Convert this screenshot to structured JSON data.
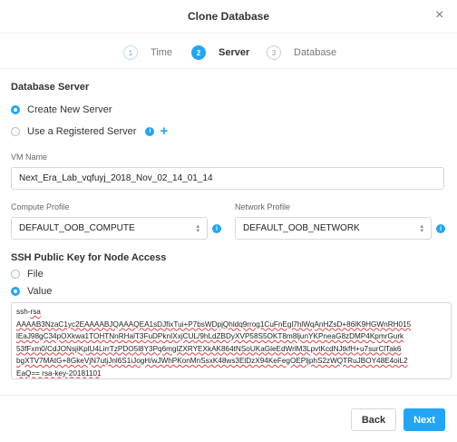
{
  "dialog": {
    "title": "Clone Database",
    "close_icon": "×"
  },
  "steps": [
    {
      "num": "1",
      "label": "Time"
    },
    {
      "num": "2",
      "label": "Server"
    },
    {
      "num": "3",
      "label": "Database"
    }
  ],
  "database_server": {
    "heading": "Database Server",
    "options": [
      "Create New Server",
      "Use a Registered Server"
    ],
    "selected": 0,
    "info": "i",
    "add": "+"
  },
  "vm_name": {
    "label": "VM Name",
    "value": "Next_Era_Lab_vqfuyj_2018_Nov_02_14_01_14"
  },
  "compute_profile": {
    "label": "Compute Profile",
    "value": "DEFAULT_OOB_COMPUTE"
  },
  "network_profile": {
    "label": "Network Profile",
    "value": "DEFAULT_OOB_NETWORK"
  },
  "ssh": {
    "heading": "SSH Public Key for Node Access",
    "options": [
      "File",
      "Value"
    ],
    "selected": 1,
    "value_lines": [
      "ssh-rsa",
      "AAAAB3NzaC1yc2EAAAABJQAAAQEA1sDJfixTui+P7bsWDpjQhldq9rrog1CuFnEgl7hlWqAnHZsD+86lK9HGWnRH015",
      "lEaJ98gC34pOXkwa1TOHTNnRHalT3FuDPknIXxjCUL/9hLdZBDyXVP58S5OKT8m8ljunYKPneaG8zDMP4KpmrGurk",
      "53fFxm0/CdJONsjiKplU4LirrTzPDO5l8Y3Pq6mglZXRYEXkAK864tNSoUKaGleEdWrlM3LpvtKcdNJtkfH+u7surClTak6",
      "bgXTV7MAtG+8GkeVjN7utjJnl6S1iJogH/wJWhPKonMnSsxK48ws3ElDzX94KeFegOEPljphS2zWQTRuJBOY48E4oiL2",
      "EaQ== rsa-key-20181101"
    ]
  },
  "footer": {
    "back": "Back",
    "next": "Next"
  },
  "colors": {
    "accent": "#22a5f7"
  }
}
